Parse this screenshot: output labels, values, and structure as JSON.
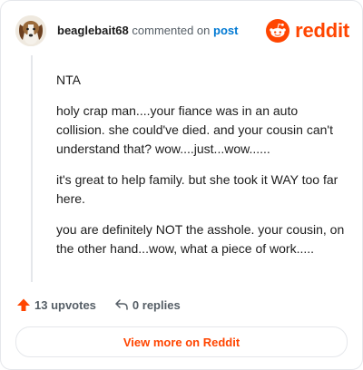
{
  "header": {
    "username": "beaglebait68",
    "action_text": "commented on",
    "post_link": "post",
    "brand_name": "reddit",
    "brand_icon": "reddit-alien-icon",
    "avatar_icon": "beagle-avatar"
  },
  "comment": {
    "paragraphs": [
      "NTA",
      "holy crap man....your fiance was in an auto collision. she could've died. and your cousin can't understand that? wow....just...wow......",
      "it's great to help family. but she took it WAY too far here.",
      "you are definitely NOT the asshole. your cousin, on the other hand...wow, what a piece of work....."
    ]
  },
  "actions": {
    "upvotes_label": "13 upvotes",
    "replies_label": "0 replies",
    "upvote_icon": "upvote-arrow-icon",
    "reply_icon": "reply-arrow-icon"
  },
  "footer": {
    "view_more_label": "View more on Reddit"
  },
  "colors": {
    "brand": "#ff4500",
    "link": "#0079d3",
    "text": "#1c1c1c",
    "muted": "#555e66",
    "border": "#e5e7eb"
  }
}
